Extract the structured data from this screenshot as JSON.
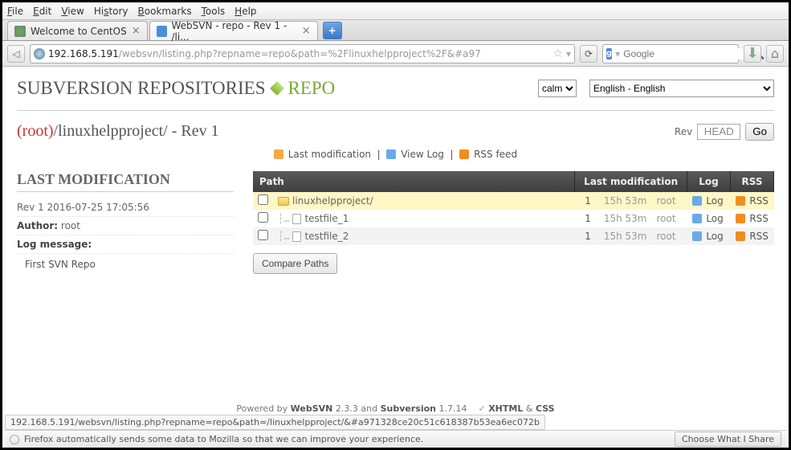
{
  "menu": {
    "items": [
      "File",
      "Edit",
      "View",
      "History",
      "Bookmarks",
      "Tools",
      "Help"
    ]
  },
  "tabs": {
    "items": [
      {
        "title": "Welcome to CentOS",
        "active": false
      },
      {
        "title": "WebSVN - repo - Rev 1 - /li...",
        "active": true
      }
    ],
    "new_label": "+"
  },
  "url": {
    "host": "192.168.5.191",
    "path": "/websvn/listing.php?repname=repo&path=%2Flinuxhelpproject%2F&#a97"
  },
  "search": {
    "engine_letter": "g",
    "placeholder": "Google"
  },
  "page": {
    "title_main": "SUBVERSION REPOSITORIES",
    "title_repo": "REPO",
    "theme_select": "calm",
    "lang_select": "English - English",
    "path_root": "(root)",
    "path_rest": "/linuxhelpproject/ - Rev 1",
    "rev_label": "Rev",
    "rev_value": "HEAD",
    "go_label": "Go",
    "actions": {
      "last_mod": "Last modification",
      "view_log": "View Log",
      "rss": "RSS feed"
    },
    "sidebar": {
      "heading": "LAST MODIFICATION",
      "rev_line": "Rev 1 2016-07-25 17:05:56",
      "author_label": "Author:",
      "author_value": "root",
      "log_label": "Log message:",
      "log_msg": "First SVN Repo"
    },
    "table": {
      "headers": {
        "path": "Path",
        "lastmod": "Last modification",
        "log": "Log",
        "rss": "RSS"
      },
      "rows": [
        {
          "name": "linuxhelpproject/",
          "type": "folder",
          "rev": "1",
          "age": "15h 53m",
          "author": "root",
          "highlight": true,
          "indent": 0
        },
        {
          "name": "testfile_1",
          "type": "file",
          "rev": "1",
          "age": "15h 53m",
          "author": "root",
          "highlight": false,
          "indent": 1
        },
        {
          "name": "testfile_2",
          "type": "file",
          "rev": "1",
          "age": "15h 53m",
          "author": "root",
          "highlight": false,
          "indent": 1
        }
      ],
      "log_label": "Log",
      "rss_label": "RSS",
      "compare_label": "Compare Paths"
    },
    "footer": {
      "powered": "Powered by",
      "websvn": "WebSVN",
      "websvn_ver": "2.3.3",
      "and": "and",
      "svn": "Subversion",
      "svn_ver": "1.7.14",
      "xhtml": "XHTML",
      "amp": "&",
      "css": "CSS"
    }
  },
  "status_url": "192.168.5.191/websvn/listing.php?repname=repo&path=/linuxhelpproject/&#a971328ce20c51c618387b53ea6ec072b",
  "notice": {
    "text": "Firefox automatically sends some data to Mozilla so that we can improve your experience.",
    "button": "Choose What I Share"
  }
}
